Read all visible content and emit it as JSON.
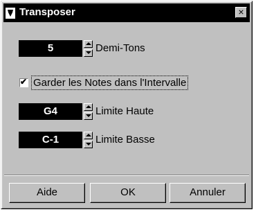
{
  "window": {
    "title": "Transposer",
    "close_label": "×"
  },
  "semitones": {
    "value": "5",
    "label": "Demi-Tons"
  },
  "keep_notes": {
    "label": "Garder les Notes dans l'Intervalle",
    "checked": true
  },
  "upper_limit": {
    "value": "G4",
    "label": "Limite Haute"
  },
  "lower_limit": {
    "value": "C-1",
    "label": "Limite Basse"
  },
  "buttons": {
    "help": "Aide",
    "ok": "OK",
    "cancel": "Annuler"
  }
}
